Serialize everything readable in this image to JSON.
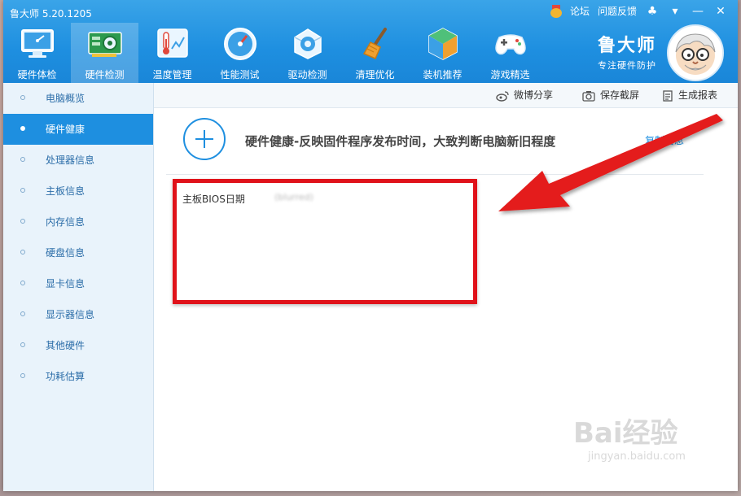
{
  "app": {
    "title": "鲁大师 5.20.1205"
  },
  "top_links": {
    "forum": "论坛",
    "feedback": "问题反馈"
  },
  "nav": [
    {
      "label": "硬件体检",
      "icon": "monitor-icon"
    },
    {
      "label": "硬件检测",
      "icon": "hardware-card-icon"
    },
    {
      "label": "温度管理",
      "icon": "thermometer-icon"
    },
    {
      "label": "性能测试",
      "icon": "speedometer-icon"
    },
    {
      "label": "驱动检测",
      "icon": "driver-gear-icon"
    },
    {
      "label": "清理优化",
      "icon": "broom-icon"
    },
    {
      "label": "装机推荐",
      "icon": "cube-icon"
    },
    {
      "label": "游戏精选",
      "icon": "gamepad-icon"
    }
  ],
  "active_nav": "硬件检测",
  "brand": {
    "name": "鲁大师",
    "slogan": "专注硬件防护"
  },
  "sidebar": {
    "items": [
      {
        "label": "电脑概览"
      },
      {
        "label": "硬件健康"
      },
      {
        "label": "处理器信息"
      },
      {
        "label": "主板信息"
      },
      {
        "label": "内存信息"
      },
      {
        "label": "硬盘信息"
      },
      {
        "label": "显卡信息"
      },
      {
        "label": "显示器信息"
      },
      {
        "label": "其他硬件"
      },
      {
        "label": "功耗估算"
      }
    ],
    "active": "硬件健康"
  },
  "toolbar": {
    "share": "微博分享",
    "screenshot": "保存截屏",
    "report": "生成报表"
  },
  "hero": {
    "title": "硬件健康-反映固件程序发布时间，大致判断电脑新旧程度",
    "link": "复制信息"
  },
  "info": {
    "label": "主板BIOS日期",
    "value": "(blurred)"
  },
  "watermark": {
    "main": "Bai经验",
    "sub": "jingyan.baidu.com"
  },
  "colors": {
    "accent": "#1e8fe0",
    "highlight": "#e0121a"
  }
}
